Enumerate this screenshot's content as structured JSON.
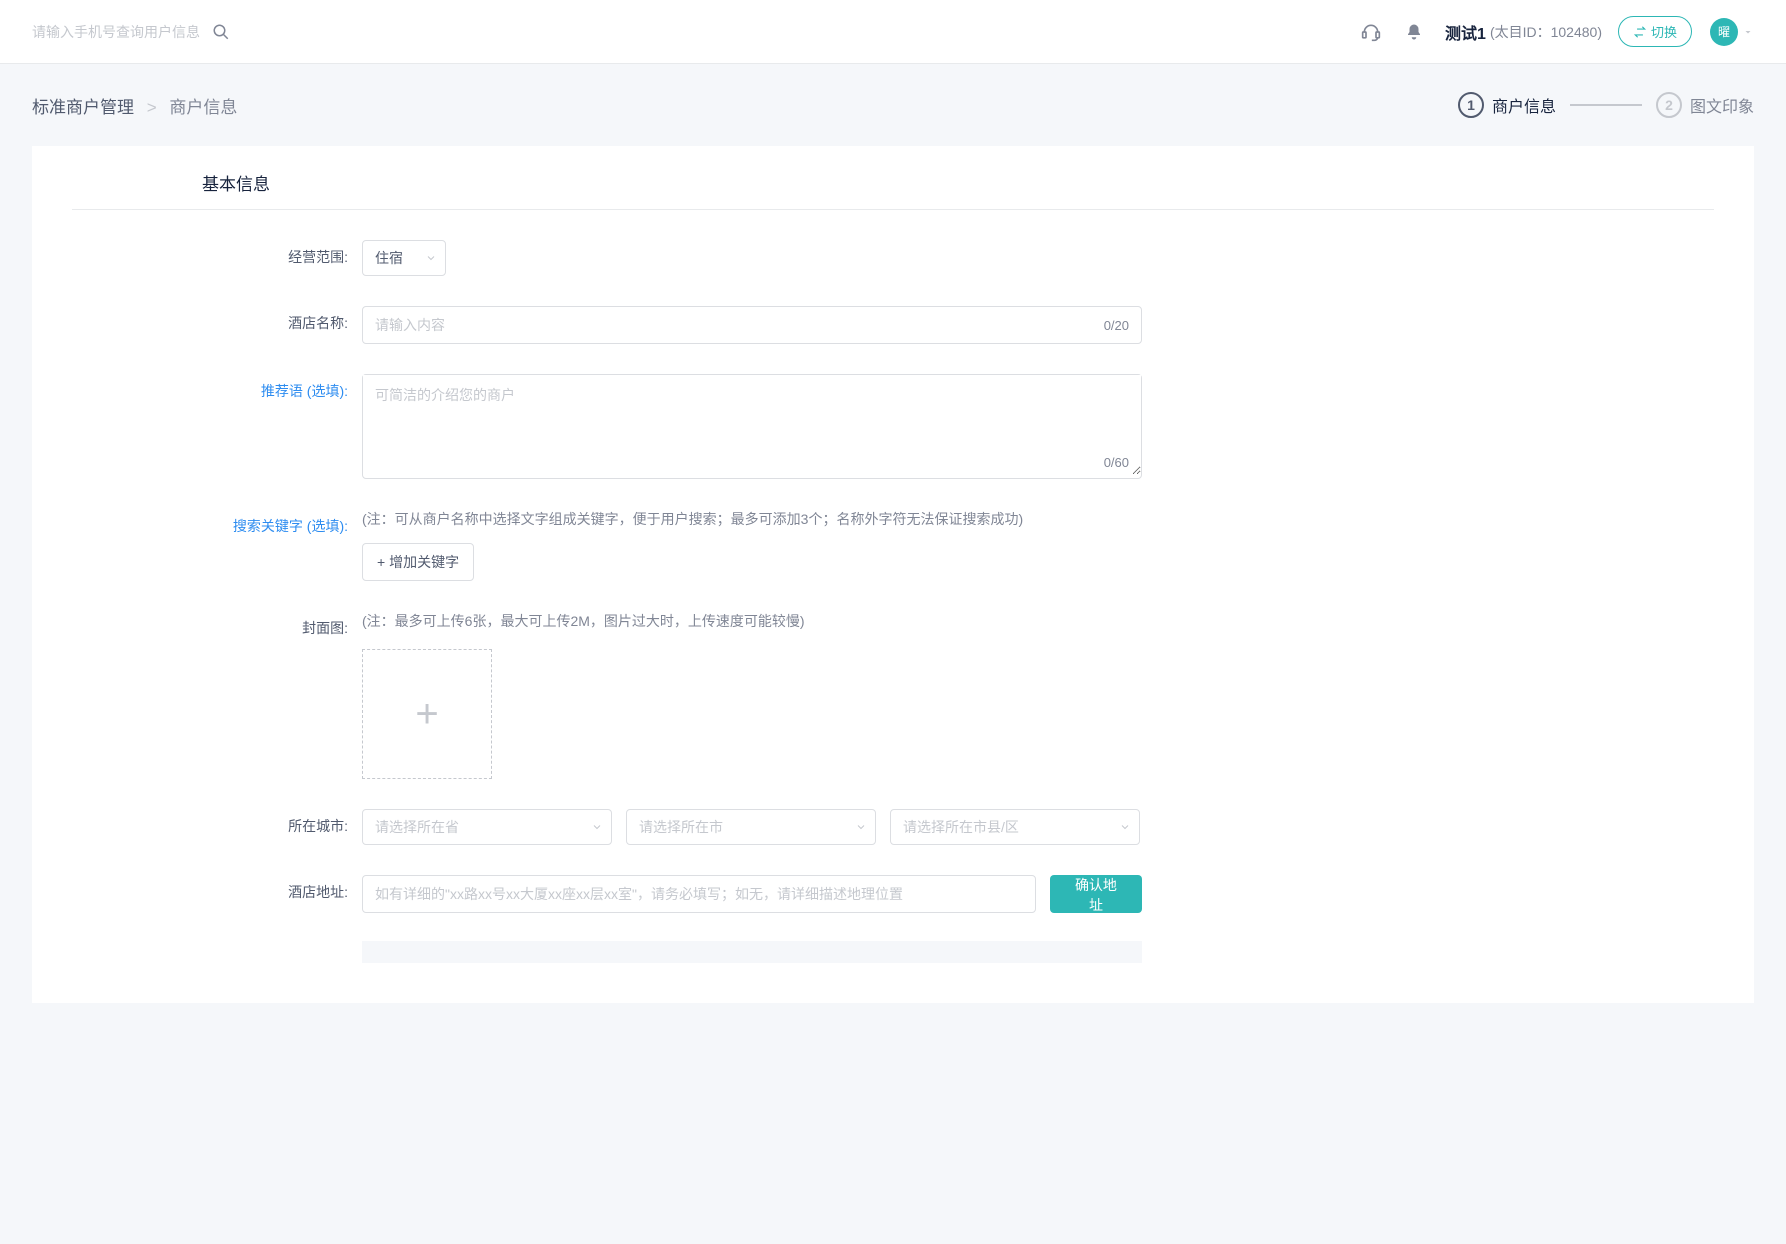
{
  "header": {
    "search_placeholder": "请输入手机号查询用户信息",
    "user_name": "测试1",
    "user_id_label": "(太目ID：102480)",
    "switch_label": "切换",
    "avatar_letter": "曜"
  },
  "breadcrumb": {
    "parent": "标准商户管理",
    "sep": ">",
    "current": "商户信息"
  },
  "steps": {
    "step1_num": "1",
    "step1_label": "商户信息",
    "step2_num": "2",
    "step2_label": "图文印象"
  },
  "form": {
    "section_title": "基本信息",
    "scope": {
      "label": "经营范围:",
      "value": "住宿"
    },
    "hotel_name": {
      "label": "酒店名称:",
      "placeholder": "请输入内容",
      "counter": "0/20"
    },
    "recommend": {
      "label": "推荐语 (选填):",
      "placeholder": "可简洁的介绍您的商户",
      "counter": "0/60"
    },
    "keywords": {
      "label": "搜索关键字 (选填):",
      "hint": "(注：可从商户名称中选择文字组成关键字，便于用户搜索；最多可添加3个；名称外字符无法保证搜索成功)",
      "add_btn": "+ 增加关键字"
    },
    "cover": {
      "label": "封面图:",
      "hint": "(注：最多可上传6张，最大可上传2M，图片过大时，上传速度可能较慢)"
    },
    "city": {
      "label": "所在城市:",
      "province_placeholder": "请选择所在省",
      "city_placeholder": "请选择所在市",
      "district_placeholder": "请选择所在市县/区"
    },
    "address": {
      "label": "酒店地址:",
      "placeholder": "如有详细的\"xx路xx号xx大厦xx座xx层xx室\"，请务必填写；如无，请详细描述地理位置",
      "confirm_btn": "确认地址"
    }
  }
}
